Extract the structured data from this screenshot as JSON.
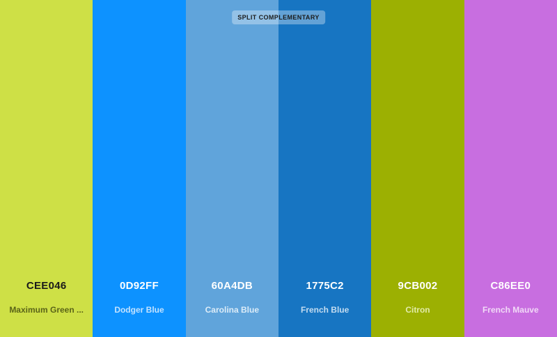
{
  "badge": {
    "label": "SPLIT COMPLEMENTARY"
  },
  "swatches": [
    {
      "hex": "CEE046",
      "name": "Maximum Green ...",
      "color": "#CEE046",
      "hex_color": "#1a1a1a",
      "name_color": "#5a6418"
    },
    {
      "hex": "0D92FF",
      "name": "Dodger Blue",
      "color": "#0D92FF",
      "hex_color": "#ffffff",
      "name_color": "#c2e2ff"
    },
    {
      "hex": "60A4DB",
      "name": "Carolina Blue",
      "color": "#60A4DB",
      "hex_color": "#ffffff",
      "name_color": "#dcecf8"
    },
    {
      "hex": "1775C2",
      "name": "French Blue",
      "color": "#1775C2",
      "hex_color": "#ffffff",
      "name_color": "#c4dcf0"
    },
    {
      "hex": "9CB002",
      "name": "Citron",
      "color": "#9CB002",
      "hex_color": "#ffffff",
      "name_color": "#e2ebaa"
    },
    {
      "hex": "C86EE0",
      "name": "French Mauve",
      "color": "#C86EE0",
      "hex_color": "#ffffff",
      "name_color": "#f1d9f7"
    }
  ]
}
